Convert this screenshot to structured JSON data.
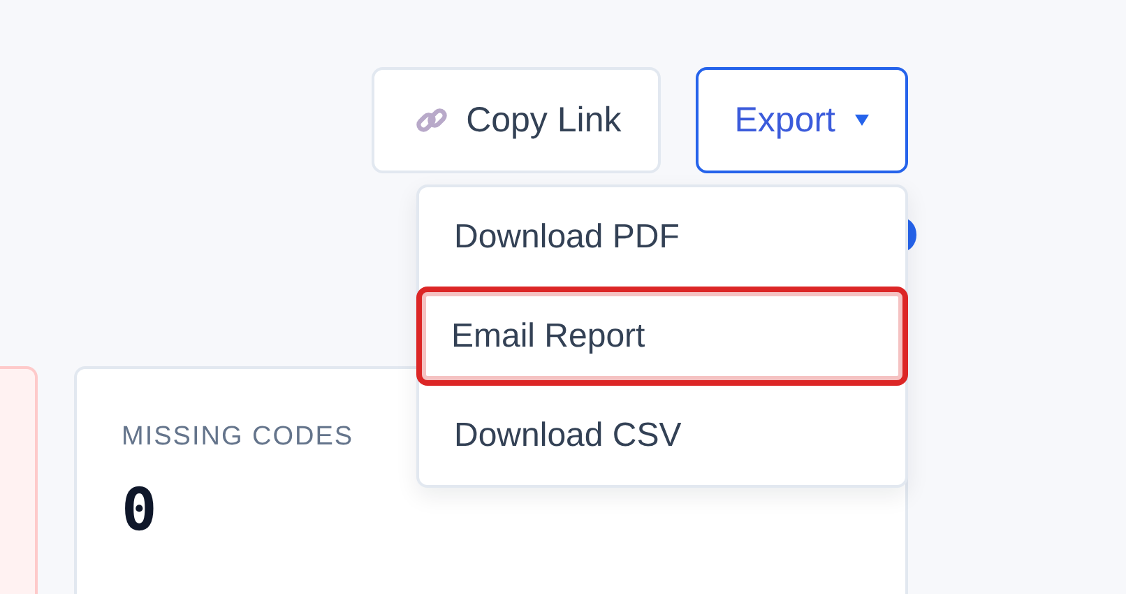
{
  "toolbar": {
    "copy_button": {
      "label": "Copy Link"
    },
    "export_button": {
      "label": "Export",
      "expanded": true
    }
  },
  "export_menu": {
    "items": [
      {
        "label": "Download PDF",
        "selected": false
      },
      {
        "label": "Email Report",
        "selected": true
      },
      {
        "label": "Download CSV",
        "selected": false
      }
    ]
  },
  "summary_cards": [
    {
      "label": "MISSING CODES",
      "value": "0"
    }
  ]
}
